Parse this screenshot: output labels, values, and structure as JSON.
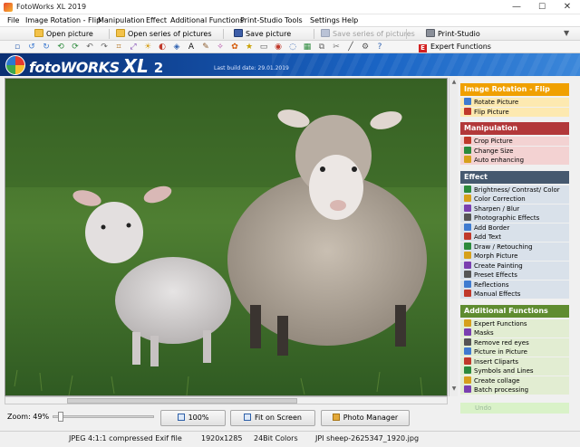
{
  "window": {
    "title": "FotoWorks XL 2019",
    "minimize": "—",
    "maximize": "☐",
    "close": "✕"
  },
  "menu": [
    "File",
    "Image Rotation - Flip",
    "Manipulation",
    "Effect",
    "Additional Functions",
    "Print-Studio",
    "Tools",
    "Settings",
    "Help"
  ],
  "toolbar": {
    "open_picture": "Open picture",
    "open_series": "Open series of pictures",
    "save_picture": "Save picture",
    "save_series": "Save series of pictures",
    "print_studio": "Print-Studio",
    "expert_functions": "Expert Functions",
    "expert_icon_letter": "E"
  },
  "tool_icons": [
    "new-file-icon",
    "rotate-left-icon",
    "rotate-right-icon",
    "rotate-ccw-icon",
    "rotate-cw-icon",
    "undo-icon",
    "redo-icon",
    "crop-icon",
    "resize-icon",
    "brightness-icon",
    "color-icon",
    "sharpen-icon",
    "add-text-icon",
    "draw-icon",
    "morph-icon",
    "painting-icon",
    "preset-icon",
    "border-icon",
    "red-eye-icon",
    "masks-icon",
    "collage-icon",
    "batch-icon",
    "clipart-icon",
    "symbols-icon",
    "settings-icon",
    "help-icon"
  ],
  "banner": {
    "brand": "fotoWORKS",
    "xl": "XL",
    "version": "2",
    "build_date": "Last build date: 29.01.2019"
  },
  "panel": {
    "sections": [
      {
        "title": "Image Rotation - Flip",
        "color": "#f0a000",
        "item_bg": "#fde9b0",
        "items": [
          "Rotate Picture",
          "Flip Picture"
        ]
      },
      {
        "title": "Manipulation",
        "color": "#b2383a",
        "item_bg": "#f3d2d2",
        "items": [
          "Crop Picture",
          "Change Size",
          "Auto enhancing"
        ]
      },
      {
        "title": "Effect",
        "color": "#46596f",
        "item_bg": "#d9e1ea",
        "items": [
          "Brightness/ Contrast/ Color",
          "Color Correction",
          "Sharpen / Blur",
          "Photographic Effects",
          "Add Border",
          "Add Text",
          "Draw / Retouching",
          "Morph Picture",
          "Create Painting",
          "Preset Effects",
          "Reflections",
          "Manual Effects"
        ]
      },
      {
        "title": "Additional Functions",
        "color": "#5f8c30",
        "item_bg": "#e2edd2",
        "items": [
          "Expert Functions",
          "Masks",
          "Remove red eyes",
          "Picture in Picture",
          "Insert Cliparts",
          "Symbols and Lines",
          "Create collage",
          "Batch processing"
        ]
      }
    ],
    "undo": "Undo"
  },
  "zoom": {
    "label": "Zoom: 49%",
    "level": 0.49
  },
  "buttons": {
    "zoom100": "100%",
    "fit": "Fit on Screen",
    "photo_manager": "Photo Manager"
  },
  "status": {
    "compression": "JPEG 4:1:1 compressed Exif file",
    "dimensions": "1920x1285",
    "colors": "24Bit Colors",
    "filename": "JPI sheep-2625347_1920.jpg"
  },
  "colors": {
    "accent_blue": "#124a9e",
    "grass": "#3e6a2c"
  }
}
